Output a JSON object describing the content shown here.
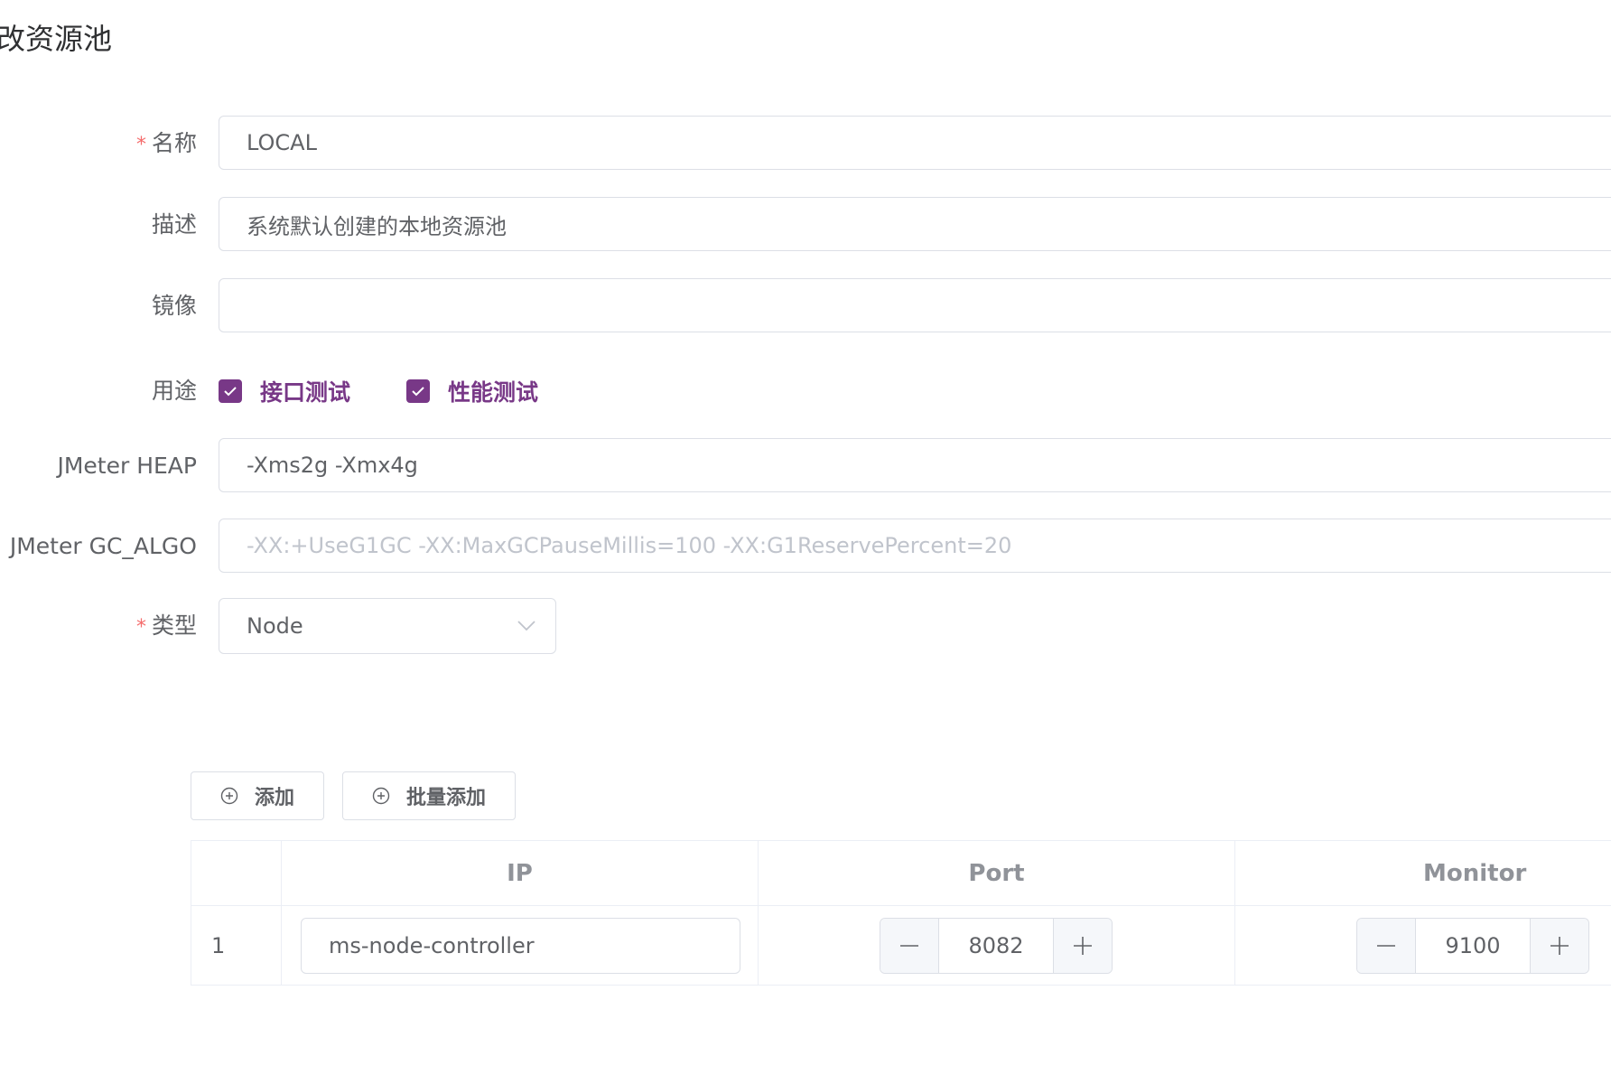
{
  "page": {
    "title": "改资源池"
  },
  "form": {
    "name": {
      "label": "名称",
      "required_mark": "*",
      "value": "LOCAL"
    },
    "description": {
      "label": "描述",
      "value": "系统默认创建的本地资源池"
    },
    "image": {
      "label": "镜像",
      "value": ""
    },
    "usage": {
      "label": "用途",
      "options": [
        {
          "label": "接口测试",
          "checked": true
        },
        {
          "label": "性能测试",
          "checked": true
        }
      ]
    },
    "jmeter_heap": {
      "label": "JMeter HEAP",
      "value": "-Xms2g -Xmx4g"
    },
    "jmeter_gc_algo": {
      "label": "JMeter GC_ALGO",
      "value": "",
      "placeholder": "-XX:+UseG1GC -XX:MaxGCPauseMillis=100 -XX:G1ReservePercent=20"
    },
    "type": {
      "label": "类型",
      "required_mark": "*",
      "value": "Node"
    }
  },
  "actions": {
    "add_label": "添加",
    "batch_add_label": "批量添加"
  },
  "table": {
    "headers": [
      "",
      "IP",
      "Port",
      "Monitor"
    ],
    "rows": [
      {
        "index": "1",
        "ip": "ms-node-controller",
        "port": "8082",
        "monitor": "9100"
      }
    ]
  },
  "colors": {
    "accent": "#783887",
    "required": "#f56c6c",
    "border": "#dcdfe6"
  }
}
